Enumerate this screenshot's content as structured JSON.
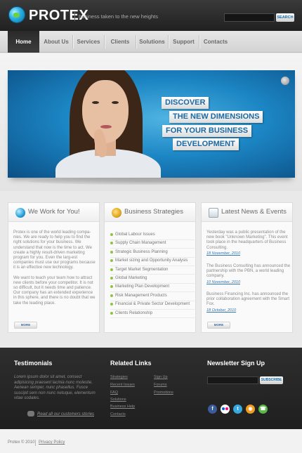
{
  "header": {
    "logo": "PROTEX",
    "slogan": "business taken to the new heights",
    "search_placeholder": "",
    "search_button": "SEARCH"
  },
  "nav": {
    "items": [
      {
        "label": "Home",
        "active": true
      },
      {
        "label": "About Us"
      },
      {
        "label": "Services"
      },
      {
        "label": "Clients"
      },
      {
        "label": "Solutions"
      },
      {
        "label": "Support"
      },
      {
        "label": "Contacts"
      }
    ]
  },
  "banner": {
    "lines": [
      "DISCOVER",
      "THE NEW DIMENSIONS",
      "FOR YOUR BUSINESS",
      "DEVELOPMENT"
    ]
  },
  "columns": {
    "work": {
      "title": "We Work for You!",
      "paragraphs": [
        "Protex is one of the world leading compa-nies. We are ready to help you to find the right solutions for your business. We understand that now is the time to act. We create a highly result-driven marketing program for you. Even the larg-est companies must use our programs because it is an effective new technology.",
        "We want to teach your team how to attract new clients before your competitor. It is not so difficult, but it needs time and patience. Our company has an extended experience in this sphere, and there is no doubt that we take the leading place."
      ],
      "more": "MORE"
    },
    "strategies": {
      "title": "Business Strategies",
      "items": [
        "Global Labour Issues",
        "Supply Chain Management",
        "Strategic Business Planning",
        "Market sizing and Opportunity Analysis",
        "Target Market Segmentation",
        "Global Marketing",
        "Marketing Plan Development",
        "Risk Management Products",
        "Financial & Private Sector Development",
        "Clients Relationship"
      ]
    },
    "news": {
      "title": "Latest News & Events",
      "items": [
        {
          "text": "Yesterday was a public presentation of the new book \"Unknown Marketing\". This event took place in the headquarters of Business Consulting.",
          "date": "18 November, 2010"
        },
        {
          "text": "The Business Consulting has announced the partnership with the PBN, a world leading company.",
          "date": "10 November, 2010"
        },
        {
          "text": "Business Financing Inc. has announced the prior collaboration agreement with the Smart Fox.",
          "date": "18 October, 2010"
        }
      ],
      "more": "MORE"
    }
  },
  "footer": {
    "testimonials": {
      "title": "Testimonials",
      "text": "Lorem ipsum dolor sit amet, consect adipisicing praesent lacinia nunc molestie. Aenean semper, nunc phasellus. Fusce suscipit sem non nunc netuque, elementum vitae sodales.",
      "link": "Read all our customers stories"
    },
    "related": {
      "title": "Related Links",
      "col1": [
        "Strategies",
        "Recent Issues",
        "FAQ",
        "Solutions",
        "Business Help",
        "Contacts"
      ],
      "col2": [
        "Sign Up",
        "Forums",
        "Promotions"
      ]
    },
    "newsletter": {
      "title": "Newsletter Sign Up",
      "button": "SUBSCRIBE",
      "social_icons": [
        "facebook-icon",
        "flickr-icon",
        "twitter-icon",
        "rss-icon",
        "phone-icon"
      ]
    }
  },
  "bottom": {
    "copyright": "Protex © 2010",
    "privacy": "Privacy Policy"
  },
  "colors": {
    "accent": "#1b6aa3",
    "bullet": "#8cc63e",
    "footer": "#262626"
  }
}
